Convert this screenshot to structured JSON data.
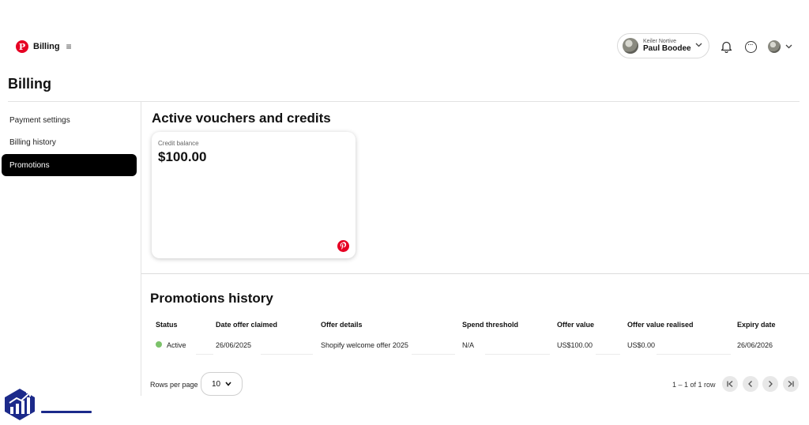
{
  "brand": {
    "label": "Billing"
  },
  "account": {
    "business_name": "Keiler Nortive",
    "user_name": "Paul Boodee"
  },
  "page_title": "Billing",
  "sidebar": {
    "items": [
      {
        "label": "Payment settings",
        "active": false
      },
      {
        "label": "Billing history",
        "active": false
      },
      {
        "label": "Promotions",
        "active": true
      }
    ]
  },
  "vouchers": {
    "title": "Active vouchers and credits",
    "credit_label": "Credit balance",
    "credit_value": "$100.00"
  },
  "history": {
    "title": "Promotions history",
    "columns": [
      "Status",
      "Date offer claimed",
      "Offer details",
      "Spend threshold",
      "Offer value",
      "Offer value realised",
      "Expiry date"
    ],
    "rows": [
      {
        "status": "Active",
        "date_claimed": "26/06/2025",
        "offer_details": "Shopify welcome offer 2025",
        "spend_threshold": "N/A",
        "offer_value": "US$100.00",
        "value_realised": "US$0.00",
        "expiry_date": "26/06/2026"
      }
    ],
    "rows_per_page_label": "Rows per page",
    "rows_per_page_value": "10",
    "pagination_info": "1 – 1 of 1 row"
  },
  "colors": {
    "brand_red": "#e60023",
    "active_nav_bg": "#000000",
    "status_active": "#7cc26a",
    "watermark_blue": "#1c2a8a"
  },
  "icons": [
    "pinterest-logo-icon",
    "menu-icon",
    "chevron-down-icon",
    "bell-icon",
    "chat-icon",
    "first-page-icon",
    "previous-page-icon",
    "next-page-icon",
    "last-page-icon",
    "analytics-logo-icon"
  ]
}
